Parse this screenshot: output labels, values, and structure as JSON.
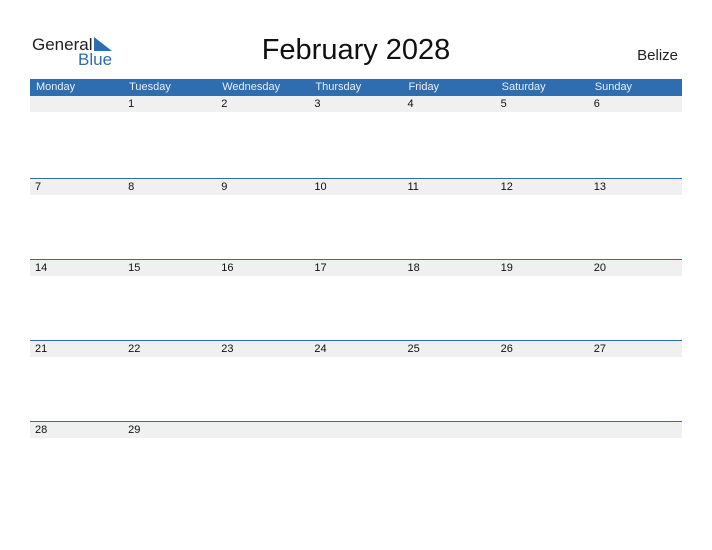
{
  "logo": {
    "word1": "General",
    "word2": "Blue"
  },
  "title": "February 2028",
  "country": "Belize",
  "colors": {
    "accent": "#2e6eb0",
    "strip": "#f0f0f0"
  },
  "weekdays": [
    "Monday",
    "Tuesday",
    "Wednesday",
    "Thursday",
    "Friday",
    "Saturday",
    "Sunday"
  ],
  "weeks": [
    [
      "",
      "1",
      "2",
      "3",
      "4",
      "5",
      "6"
    ],
    [
      "7",
      "8",
      "9",
      "10",
      "11",
      "12",
      "13"
    ],
    [
      "14",
      "15",
      "16",
      "17",
      "18",
      "19",
      "20"
    ],
    [
      "21",
      "22",
      "23",
      "24",
      "25",
      "26",
      "27"
    ],
    [
      "28",
      "29",
      "",
      "",
      "",
      "",
      ""
    ]
  ]
}
